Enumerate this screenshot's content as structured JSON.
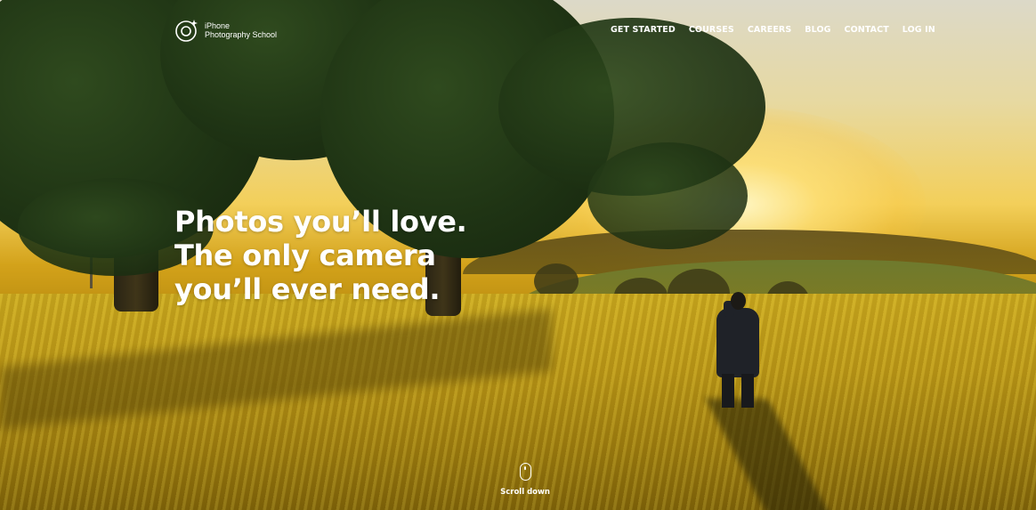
{
  "brand": {
    "name_line1": "iPhone",
    "name_line2": "Photography School",
    "logo_icon": "camera-lens-sparkle-icon"
  },
  "nav": {
    "items": [
      {
        "label": "GET STARTED"
      },
      {
        "label": "COURSES"
      },
      {
        "label": "CAREERS"
      },
      {
        "label": "BLOG"
      },
      {
        "label": "CONTACT"
      },
      {
        "label": "LOG IN"
      }
    ]
  },
  "hero": {
    "headline_line1": "Photos you’ll love.",
    "headline_line2": "The only camera",
    "headline_line3": "you’ll ever need.",
    "background": "sunset-wheat-field-photographer",
    "scroll_icon": "mouse-scroll-icon",
    "scroll_label": "Scroll down"
  },
  "colors": {
    "text": "#ffffff",
    "field": "#b89516",
    "foliage": "#1f3414"
  }
}
